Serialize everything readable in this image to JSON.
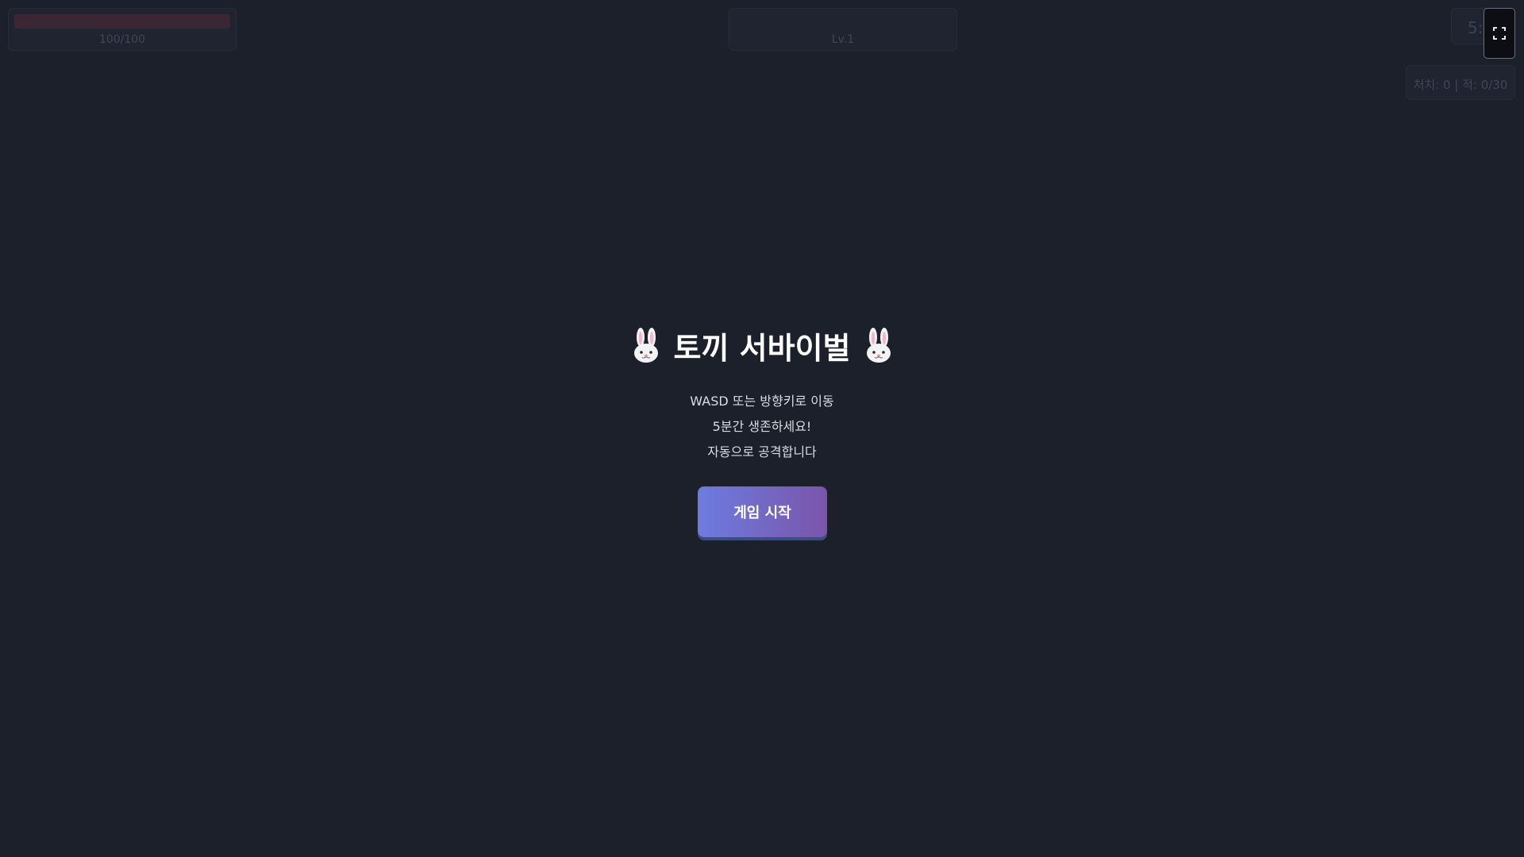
{
  "hud": {
    "hp": {
      "current": 100,
      "max": 100,
      "text": "100/100",
      "fill_fraction": 1.0
    },
    "level": {
      "text": "Lv.1"
    },
    "timer": {
      "text": "5:"
    },
    "kills": {
      "text": "처치: 0 | 적: 0/30"
    }
  },
  "fullscreen": {
    "icon": "fullscreen-icon"
  },
  "overlay": {
    "title": "토끼 서바이벌",
    "title_icon": "rabbit-icon",
    "instructions": [
      "WASD 또는 방향키로 이동",
      "5분간 생존하세요!",
      "자동으로 공격합니다"
    ],
    "start_button": "게임 시작"
  },
  "colors": {
    "background": "#1b202b",
    "button_gradient_start": "#6d7ce0",
    "button_gradient_end": "#7a55aa",
    "title": "#ffffff",
    "instruction_text": "#d9dce3"
  }
}
